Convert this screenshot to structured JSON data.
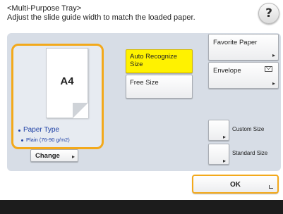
{
  "header": {
    "title": "<Multi-Purpose Tray>",
    "instruction": "Adjust the slide guide width to match the loaded paper."
  },
  "help_button": {
    "label": "?"
  },
  "paper": {
    "size": "A4",
    "type_label": "Paper Type",
    "type_value": "Plain (76-90 g/m2)",
    "change_label": "Change"
  },
  "size_options": {
    "auto_recognize_line1": "Auto Recognize",
    "auto_recognize_line2": "Size",
    "free_size": "Free Size"
  },
  "right_options": {
    "favorite_paper": "Favorite Paper",
    "envelope": "Envelope",
    "custom_size": "Custom Size",
    "standard_size": "Standard Size"
  },
  "ok_button": {
    "label": "OK"
  },
  "colors": {
    "selected_highlight": "#fff200",
    "focus_outline": "#f3a91b",
    "paper_type_text": "#1d3fa5",
    "panel_background": "#d7dde6"
  }
}
